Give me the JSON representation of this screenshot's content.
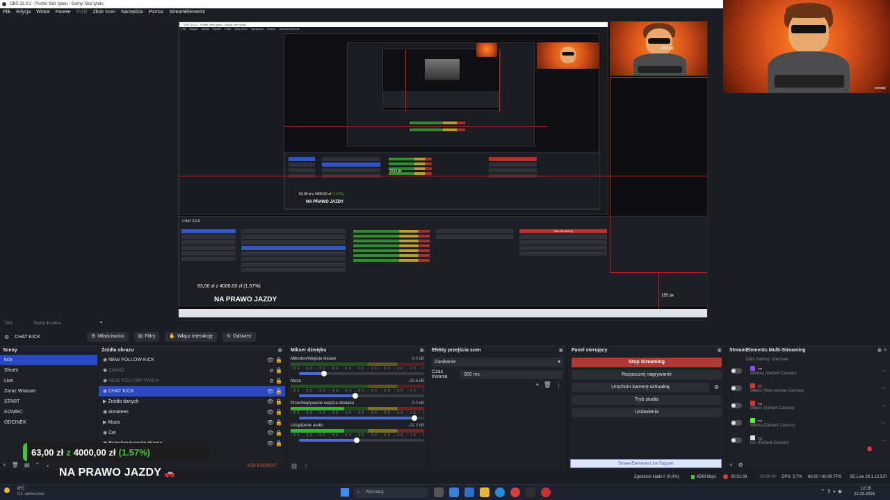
{
  "window": {
    "title": "OBS 32.0.2 - Profile: Bez tytułu - Sceny: Bez tytułu"
  },
  "menu": [
    "Plik",
    "Edycja",
    "Widok",
    "Panele",
    "Profil",
    "Zbiór scen",
    "Narzędzia",
    "Pomoc",
    "StreamElements"
  ],
  "preview": {
    "nested_title": "OBS 32.0.2 - Profile: Bez tytułu - Sceny: Bez tytułu",
    "nested_menu": [
      "Plik",
      "Edycja",
      "Widok",
      "Panele",
      "Profil",
      "Zbiór scen",
      "Narzędzia",
      "Pomoc",
      "StreamElements"
    ],
    "measure_label_1": "203 px",
    "measure_label_2": "165 px",
    "measure_label_3": "1564 px",
    "nested_banner": "NA PRAWO JAZDY",
    "nested_donation": "63,00 zł z 4000,00 zł (1.57%)",
    "nested_scene": "CHAT KICK",
    "nested_stop": "Stop Streaming"
  },
  "avatar": {
    "watermark": "runway"
  },
  "status_row": {
    "zoom": "79%",
    "fit": "Skaluj do okna"
  },
  "source_toolbar": {
    "selected": "CHAT KICK",
    "buttons": [
      "Właściwości",
      "Filtry",
      "Włącz interakcję",
      "Odśwież"
    ]
  },
  "scenes": {
    "title": "Sceny",
    "items": [
      "kick",
      "Shorts",
      "Live",
      "Zaraz Wracam",
      "START",
      "KONIEC",
      "ODCINEK"
    ],
    "selected_index": 0
  },
  "sources": {
    "title": "Źródła obrazu",
    "items": [
      {
        "name": "NEW FOLLOW KICK",
        "visible": true,
        "dim": false
      },
      {
        "name": "ZARAZ",
        "visible": false,
        "dim": true
      },
      {
        "name": "NEW FOLLOW TWICH",
        "visible": false,
        "dim": true
      },
      {
        "name": "CHAT KICK",
        "visible": true,
        "dim": false
      },
      {
        "name": "Źródło danych",
        "visible": true,
        "dim": false
      },
      {
        "name": "donatees",
        "visible": true,
        "dim": false
      },
      {
        "name": "Muza",
        "visible": true,
        "dim": false
      },
      {
        "name": "Cel",
        "visible": true,
        "dim": false
      },
      {
        "name": "Przechwytywanie ekranu",
        "visible": true,
        "dim": false
      }
    ],
    "selected_index": 3,
    "add_label": "ADD ELEMENT"
  },
  "mixer": {
    "title": "Mikser dźwięku",
    "channels": [
      {
        "name": "Mikrofon/Wejście liniowe",
        "db": "0.0 dB",
        "active": false,
        "level": 0.2
      },
      {
        "name": "Muza",
        "db": "-33.6 dB",
        "active": false,
        "level": 0.45
      },
      {
        "name": "Przechwytywanie wejścia dźwięku",
        "db": "0.0 dB",
        "active": true,
        "level": 0.92
      },
      {
        "name": "Urządzenie audio",
        "db": "-31.2 dB",
        "active": true,
        "level": 0.46
      }
    ],
    "ticks": "-60 -55 -50 -45 -40 -35 -30 -25 -20 -15 -10 -5 0"
  },
  "transitions": {
    "title": "Efekty przejścia scen",
    "selected": "Zanikanie",
    "duration_label": "Czas trwania",
    "duration_value": "300 ms"
  },
  "controls": {
    "title": "Panel sterujący",
    "buttons": [
      "Stop Streaming",
      "Rozpocznij nagrywanie",
      "Uruchom kamerę wirtualną",
      "Tryb studia",
      "Ustawienia"
    ],
    "support": "StreamElements Live Support"
  },
  "multistream": {
    "title": "StreamElements Multi-Streaming",
    "header": "OBS Setting: Unknown",
    "rows": [
      {
        "label": "wlickaą (Default Canvas)",
        "color": "#9146ff"
      },
      {
        "label": "Wlęsu (New canvas Canvas)",
        "color": "#e03535"
      },
      {
        "label": "Wlęsu (Default Canvas)",
        "color": "#e03535"
      },
      {
        "label": "Wlicku (Default Canvas)",
        "color": "#53fc18"
      },
      {
        "label": "iciu (Default Canvas)",
        "color": "#dddddd"
      }
    ]
  },
  "overlay": {
    "donation_amount": "63,00 zł",
    "donation_of": "z",
    "donation_goal": "4000,00 zł",
    "donation_percent": "(1.57%)",
    "banner": "NA PRAWO JAZDY"
  },
  "obs_status": {
    "dropped": "Zgubione klatki 0 (0,0%)",
    "bitrate": "6543 kbps",
    "live_time": "00:01:06",
    "rec_time": "00:00:00",
    "cpu": "CPU: 2,7%",
    "fps": "60,00 / 60,00 FPS",
    "se_live": "SE.Live 26.1.12.537"
  },
  "taskbar": {
    "weather_temp": "8°C",
    "weather_desc": "Cz. słonecznie",
    "search": "Wyszukaj",
    "time": "12:15",
    "date": "21.03.2026"
  },
  "colors": {
    "accent": "#2a48c5",
    "stop": "#b03a33",
    "bg": "#1f2026"
  }
}
